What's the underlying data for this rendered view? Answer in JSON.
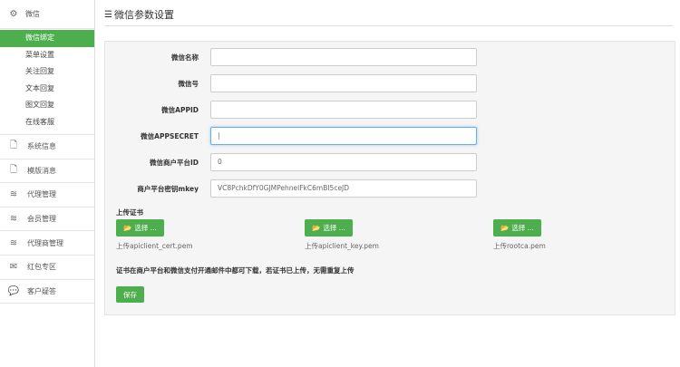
{
  "sidebar": {
    "group": {
      "label": "微信",
      "icon": "gears-icon"
    },
    "subitems": [
      "微信绑定",
      "菜单设置",
      "关注回复",
      "文本回复",
      "图文回复",
      "在线客服"
    ],
    "active": "微信绑定",
    "items": [
      {
        "label": "系统信息",
        "icon": "file-icon"
      },
      {
        "label": "模版消息",
        "icon": "file-icon"
      },
      {
        "label": "代理管理",
        "icon": "rss-icon"
      },
      {
        "label": "会员管理",
        "icon": "rss-icon"
      },
      {
        "label": "代理商管理",
        "icon": "rss-icon"
      },
      {
        "label": "红包专区",
        "icon": "envelope-icon"
      },
      {
        "label": "客户疑答",
        "icon": "chat-icon"
      }
    ]
  },
  "page": {
    "title": "微信参数设置"
  },
  "form": {
    "fields": [
      {
        "label": "微信名称",
        "value": ""
      },
      {
        "label": "微信号",
        "value": ""
      },
      {
        "label": "微信APPID",
        "value": ""
      },
      {
        "label": "微信APPSECRET",
        "value": "|"
      },
      {
        "label": "微信商户平台ID",
        "value": "0"
      },
      {
        "label": "商户平台密钥mkey",
        "value": "VC8PchkDfY0GJMPehnelFkC6mBI5ceJD"
      }
    ],
    "upload_label": "上传证书",
    "uploads": [
      {
        "button": "选择 ...",
        "caption": "上传apiclient_cert.pem"
      },
      {
        "button": "选择 ...",
        "caption": "上传apiclient_key.pem"
      },
      {
        "button": "选择 ...",
        "caption": "上传rootca.pem"
      }
    ],
    "note": "证书在商户平台和微信支付开通邮件中都可下载，若证书已上传，无需重复上传",
    "save": "保存"
  },
  "colors": {
    "accent": "#4cae4c"
  }
}
